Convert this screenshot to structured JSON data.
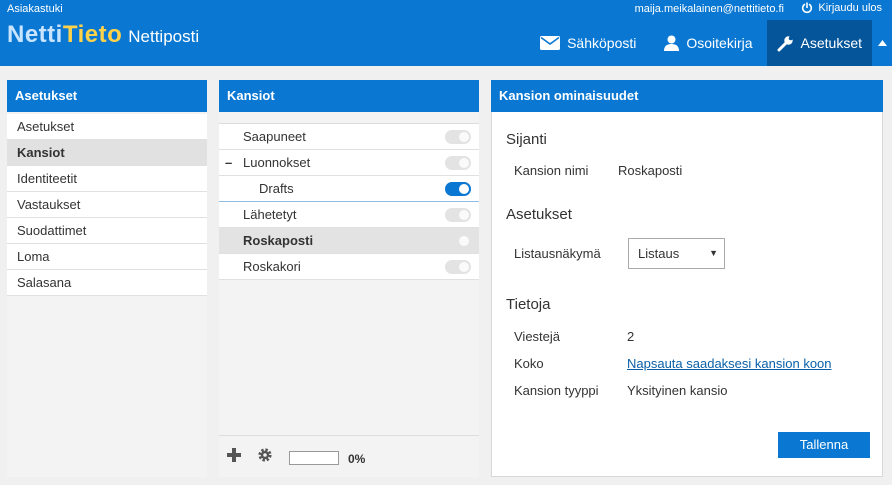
{
  "header": {
    "top_left": "Asiakastuki",
    "user_email": "maija.meikalainen@nettitieto.fi",
    "logout_label": "Kirjaudu ulos",
    "logo": {
      "part1": "Netti",
      "part2": "Tieto",
      "sub": "Nettiposti"
    },
    "nav": [
      {
        "label": "Sähköposti",
        "icon": "envelope-icon"
      },
      {
        "label": "Osoitekirja",
        "icon": "person-icon"
      },
      {
        "label": "Asetukset",
        "icon": "wrench-icon",
        "active": true
      }
    ]
  },
  "settings_panel": {
    "title": "Asetukset",
    "items": [
      "Asetukset",
      "Kansiot",
      "Identiteetit",
      "Vastaukset",
      "Suodattimet",
      "Loma",
      "Salasana"
    ],
    "selected": "Kansiot"
  },
  "folders_panel": {
    "title": "Kansiot",
    "folders": [
      {
        "name": "Saapuneet",
        "subscribed": false
      },
      {
        "name": "Luonnokset",
        "subscribed": false,
        "collapse": "–"
      },
      {
        "name": "Drafts",
        "subscribed": true,
        "level": 2
      },
      {
        "name": "Lähetetyt",
        "subscribed": false
      },
      {
        "name": "Roskaposti",
        "subscribed": false,
        "selected": true
      },
      {
        "name": "Roskakori",
        "subscribed": false
      }
    ],
    "quota_percent": 0,
    "quota_text": "0%"
  },
  "props_panel": {
    "title": "Kansion ominaisuudet",
    "location_section": "Sijanti",
    "folder_name_label": "Kansion nimi",
    "folder_name_value": "Roskaposti",
    "settings_section": "Asetukset",
    "view_label": "Listausnäkymä",
    "view_value": "Listaus",
    "info_section": "Tietoja",
    "messages_label": "Viestejä",
    "messages_value": "2",
    "size_label": "Koko",
    "size_link": "Napsauta saadaksesi kansion koon",
    "type_label": "Kansion tyyppi",
    "type_value": "Yksityinen kansio",
    "save_label": "Tallenna"
  },
  "colors": {
    "accent": "#0a78d2",
    "active_nav": "#04559a",
    "logo_tieto": "#ffd24a"
  }
}
